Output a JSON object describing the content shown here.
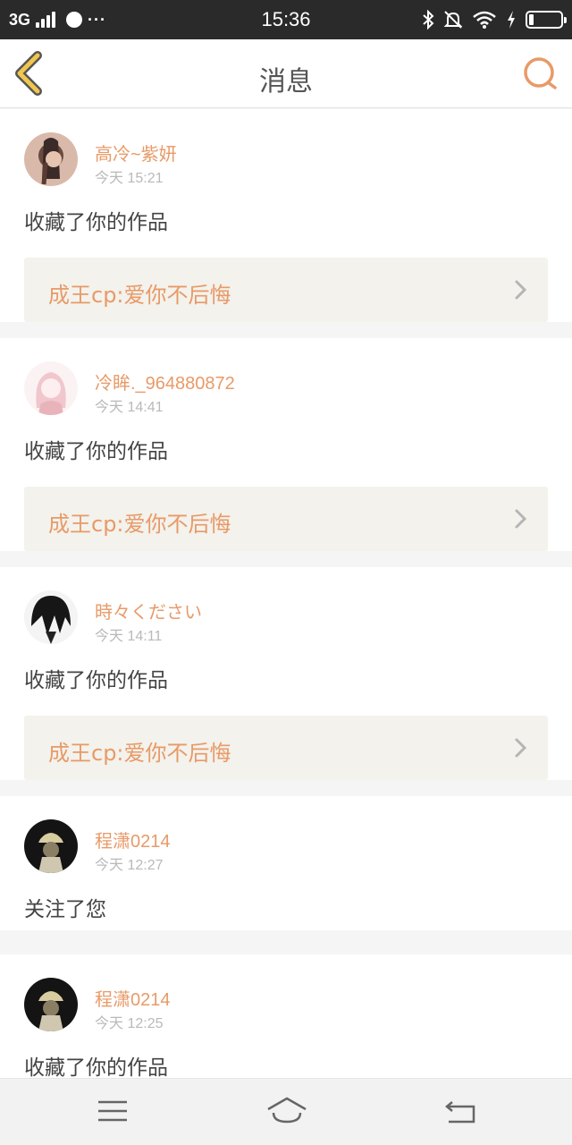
{
  "status_bar": {
    "network": "3G",
    "more": "···",
    "time": "15:36",
    "battery_level": 0.15,
    "icons": [
      "signal-icon",
      "app-notification-icon",
      "bluetooth-icon",
      "mute-icon",
      "wifi-icon",
      "charging-icon",
      "battery-icon"
    ]
  },
  "header": {
    "title": "消息",
    "back_icon": "back-chevron-icon",
    "search_icon": "search-icon"
  },
  "colors": {
    "accent": "#e89a68",
    "header_icon": "#e8b84a",
    "link_bg": "#f3f2ec"
  },
  "messages": [
    {
      "username": "高冷~紫妍",
      "time": "今天 15:21",
      "action": "收藏了你的作品",
      "work": "成王cp:爱你不后悔"
    },
    {
      "username": "冷眸._964880872",
      "time": "今天 14:41",
      "action": "收藏了你的作品",
      "work": "成王cp:爱你不后悔"
    },
    {
      "username": "時々ください",
      "time": "今天 14:11",
      "action": "收藏了你的作品",
      "work": "成王cp:爱你不后悔"
    },
    {
      "username": "程潇0214",
      "time": "今天 12:27",
      "action": "关注了您"
    },
    {
      "username": "程潇0214",
      "time": "今天 12:25",
      "action": "收藏了你的作品"
    }
  ],
  "nav": {
    "icons": [
      "menu-icon",
      "home-icon",
      "return-icon"
    ]
  }
}
